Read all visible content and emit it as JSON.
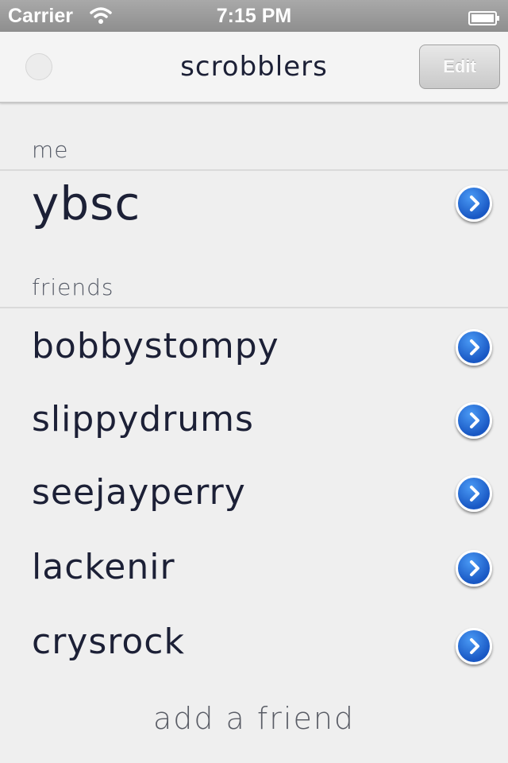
{
  "status_bar": {
    "carrier": "Carrier",
    "time": "7:15 PM",
    "wifi_icon": "wifi-icon",
    "battery_icon": "battery-icon"
  },
  "nav": {
    "title": "scrobblers",
    "edit_label": "Edit",
    "spinner_icon": "activity-spinner-icon"
  },
  "me_section": {
    "header": "me",
    "user": "ybsc"
  },
  "friends_section": {
    "header": "friends",
    "friends": [
      "bobbystompy",
      "slippydrums",
      "seejayperry",
      "lackenir",
      "crysrock"
    ]
  },
  "add_friend_label": "add a friend",
  "colors": {
    "accent_blue": "#2a6fd6",
    "text": "#1c2036",
    "background": "#efefef"
  }
}
